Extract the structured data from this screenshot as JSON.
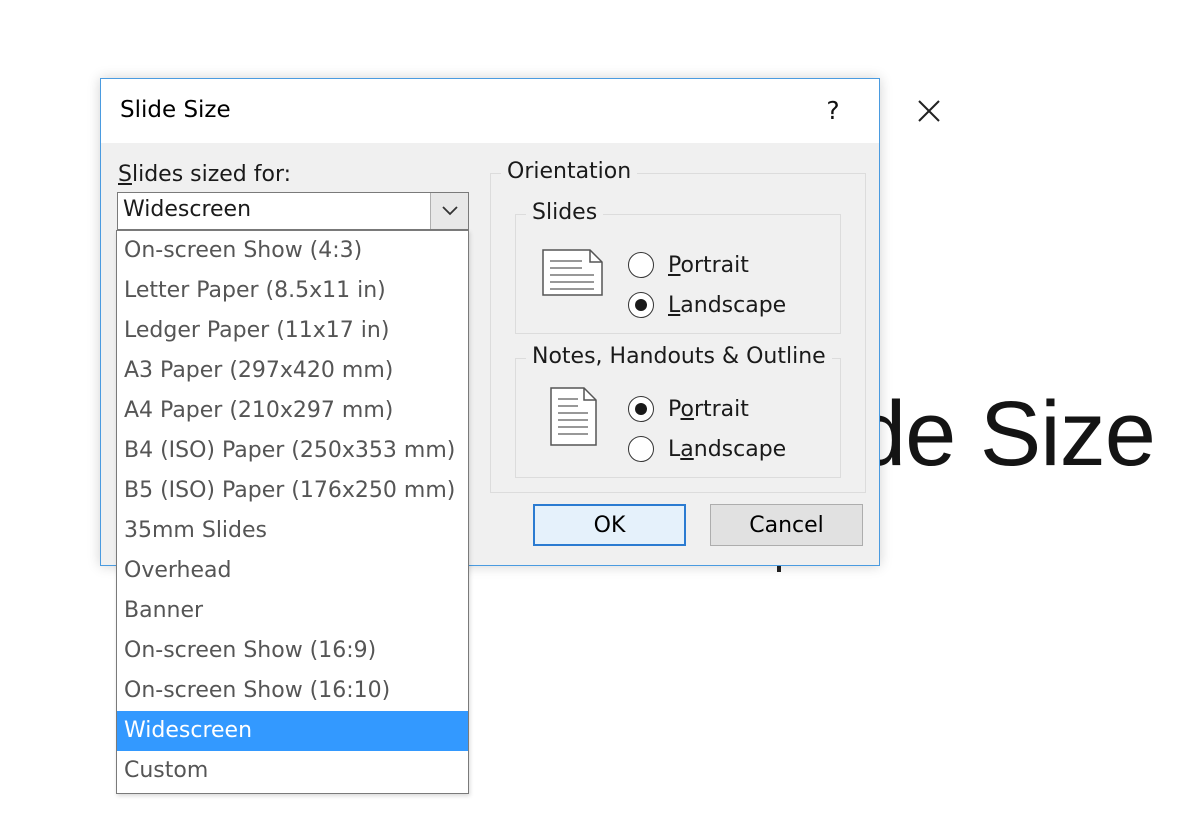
{
  "background": {
    "title": "de Size"
  },
  "dialog": {
    "title": "Slide Size",
    "help_label": "?",
    "size_label": "Slides sized for:",
    "size_label_mnemonic": "S",
    "size_label_rest": "lides sized for:",
    "selected_size": "Widescreen",
    "size_options": [
      "On-screen Show (4:3)",
      "Letter Paper (8.5x11 in)",
      "Ledger Paper (11x17 in)",
      "A3 Paper (297x420 mm)",
      "A4 Paper (210x297 mm)",
      "B4 (ISO) Paper (250x353 mm)",
      "B5 (ISO) Paper (176x250 mm)",
      "35mm Slides",
      "Overhead",
      "Banner",
      "On-screen Show (16:9)",
      "On-screen Show (16:10)",
      "Widescreen",
      "Custom"
    ],
    "orientation": {
      "label": "Orientation",
      "slides": {
        "label": "Slides",
        "portrait": {
          "mnemonic": "P",
          "rest": "ortrait",
          "checked": false
        },
        "landscape": {
          "mnemonic": "L",
          "rest": "andscape",
          "checked": true
        }
      },
      "notes": {
        "label": "Notes, Handouts & Outline",
        "portrait": {
          "before": "P",
          "mnemonic": "o",
          "rest": "rtrait",
          "checked": true
        },
        "landscape": {
          "before": "L",
          "mnemonic": "a",
          "rest": "ndscape",
          "checked": false
        }
      }
    },
    "ok_label": "OK",
    "cancel_label": "Cancel"
  },
  "colors": {
    "highlight": "#3399ff",
    "dialog_border": "#4a9be0",
    "default_button_border": "#2b7bd1"
  }
}
